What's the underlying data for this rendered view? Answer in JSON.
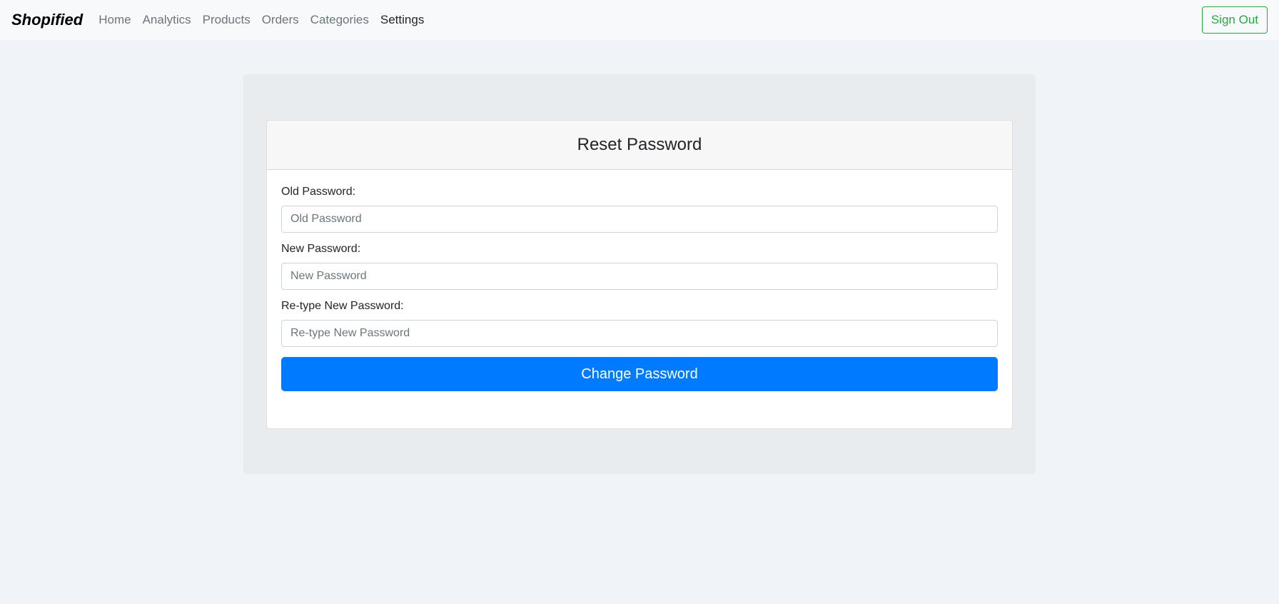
{
  "navbar": {
    "brand": "Shopified",
    "links": [
      {
        "label": "Home"
      },
      {
        "label": "Analytics"
      },
      {
        "label": "Products"
      },
      {
        "label": "Orders"
      },
      {
        "label": "Categories"
      },
      {
        "label": "Settings",
        "active": true
      }
    ],
    "signout_label": "Sign Out"
  },
  "reset_form": {
    "title": "Reset Password",
    "old_password": {
      "label": "Old Password:",
      "placeholder": "Old Password",
      "value": ""
    },
    "new_password": {
      "label": "New Password:",
      "placeholder": "New Password",
      "value": ""
    },
    "retype_password": {
      "label": "Re-type New Password:",
      "placeholder": "Re-type New Password",
      "value": ""
    },
    "submit_label": "Change Password"
  },
  "colors": {
    "primary": "#007bff",
    "success": "#28a745",
    "page_background": "#f0f4f8",
    "panel_background": "#e9ecef"
  }
}
